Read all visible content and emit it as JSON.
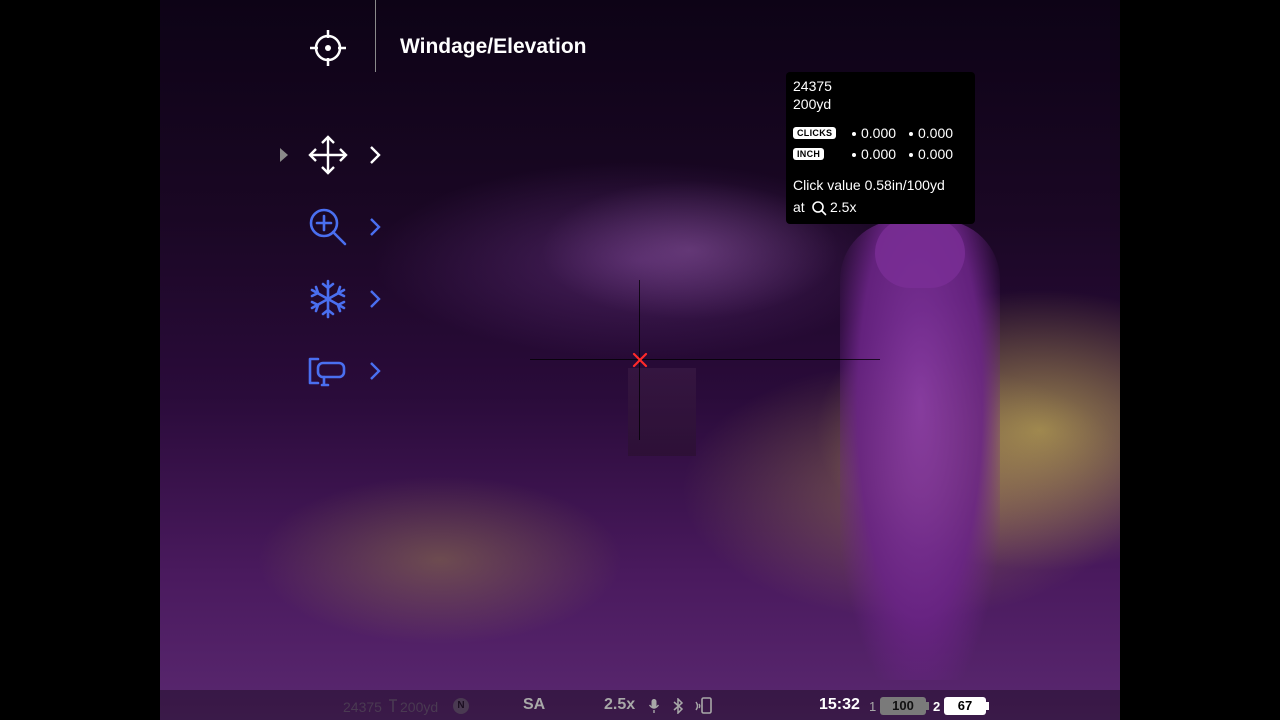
{
  "header": {
    "icon": "crosshair-icon",
    "title": "Windage/Elevation"
  },
  "menu": {
    "items": [
      {
        "icon": "move-arrows-icon",
        "color": "#ffffff",
        "selected": true
      },
      {
        "icon": "zoom-in-icon",
        "color": "#4a6ff0",
        "selected": false
      },
      {
        "icon": "freeze-icon",
        "color": "#4a6ff0",
        "selected": false
      },
      {
        "icon": "rifle-profile-icon",
        "color": "#4a6ff0",
        "selected": false
      }
    ]
  },
  "info": {
    "profile": "24375",
    "distance": "200yd",
    "clicks_tag": "CLICKS",
    "clicks_x": "0.000",
    "clicks_y": "0.000",
    "inch_tag": "INCH",
    "inch_x": "0.000",
    "inch_y": "0.000",
    "click_value": "Click value 0.58in/100yd",
    "at_label": "at",
    "zoom": "2.5x"
  },
  "status": {
    "profile": "24375",
    "distance": "200yd",
    "badge": "N",
    "mode": "SA",
    "zoom": "2.5x",
    "time": "15:32",
    "battery1_index": "1",
    "battery1_level": "100",
    "battery2_index": "2",
    "battery2_level": "67"
  },
  "colors": {
    "accent": "#4a6ff0",
    "reticle": "#ff2a2a"
  }
}
